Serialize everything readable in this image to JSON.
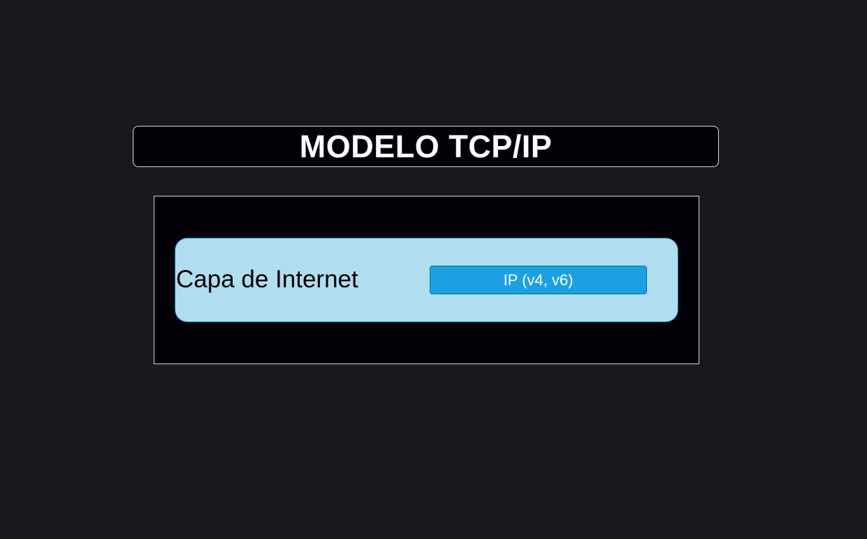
{
  "title": "MODELO TCP/IP",
  "layer": {
    "label": "Capa de Internet",
    "protocols": [
      "IP (v4, v6)"
    ]
  },
  "colors": {
    "background": "#1a171e",
    "panel": "#020108",
    "layer_fill": "#b1ddf0",
    "protocol_fill": "#1ba1e2",
    "text_light": "#ffffff",
    "text_dark": "#000000"
  }
}
